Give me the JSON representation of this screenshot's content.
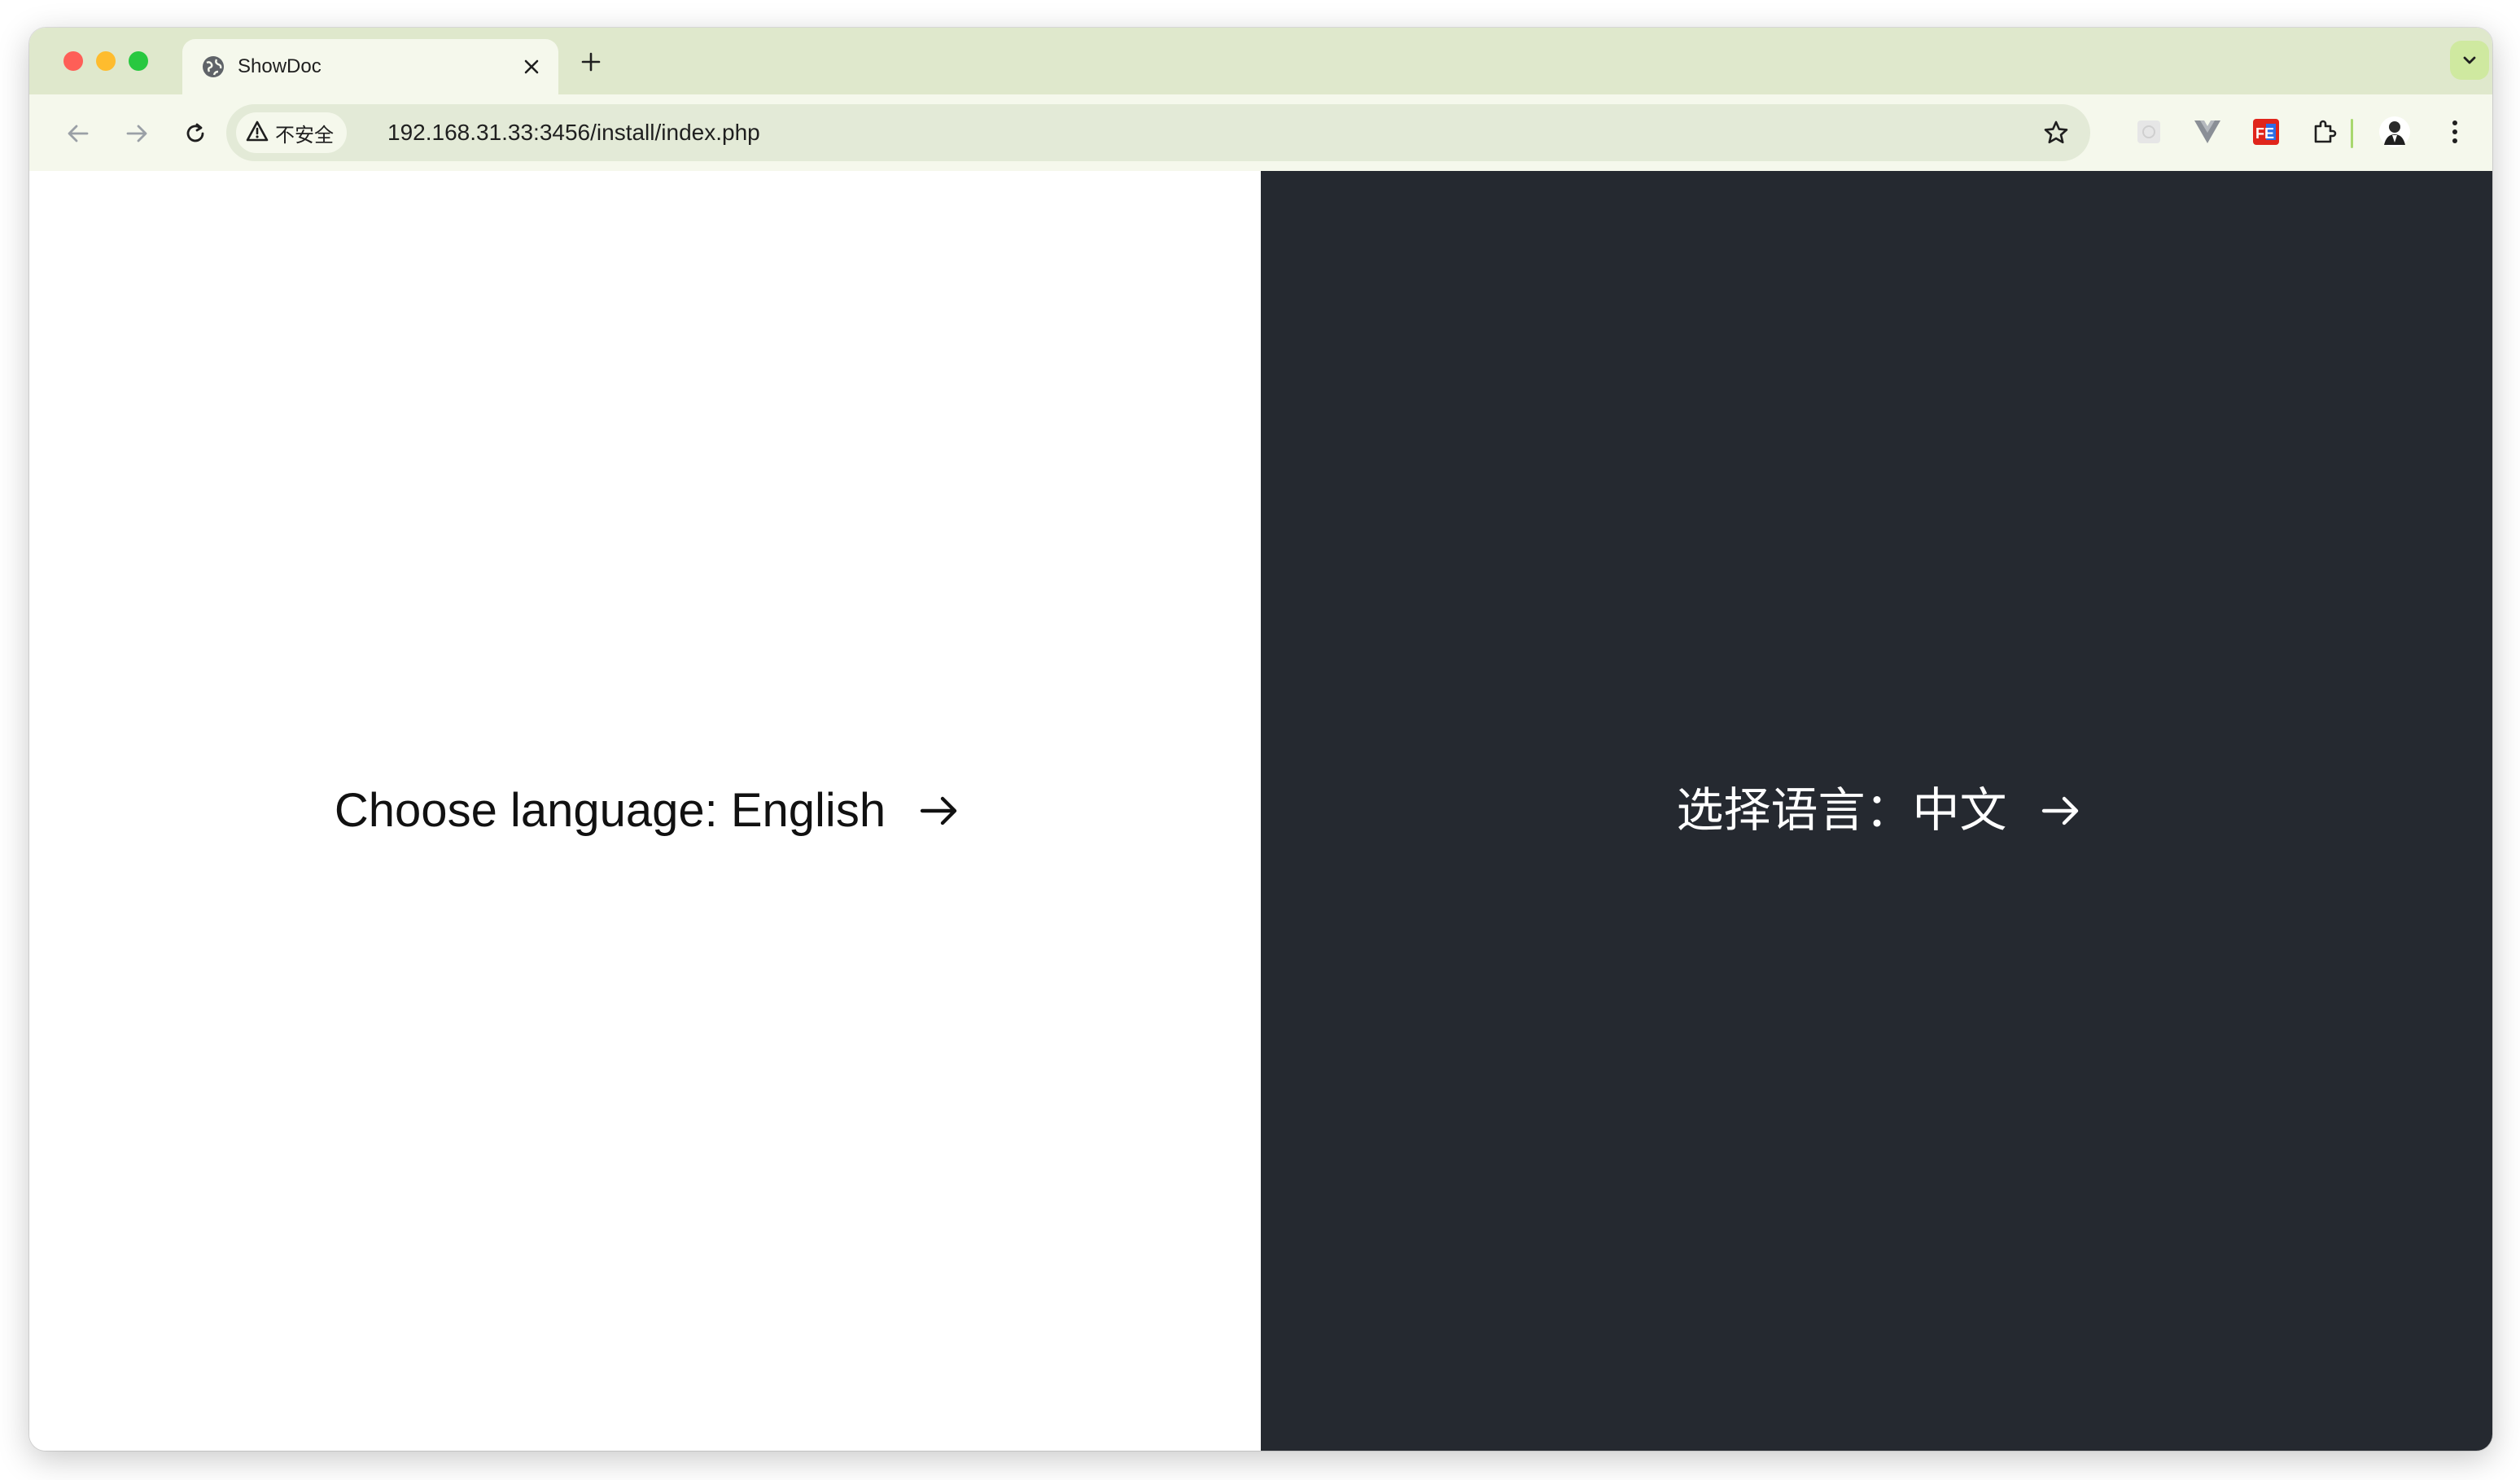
{
  "browser": {
    "tab": {
      "title": "ShowDoc",
      "close_glyph": "✕"
    },
    "new_tab_glyph": "+",
    "address_bar": {
      "security_label": "不安全",
      "url": "192.168.31.33:3456/install/index.php"
    },
    "colors": {
      "tabstrip": "#dfe8cc",
      "toolbar": "#f5f8ec",
      "omnibox": "#e3ead7"
    },
    "icons": [
      "back-icon",
      "forward-icon",
      "reload-icon",
      "warning-icon",
      "bookmark-star-icon",
      "extension-icon",
      "profile-avatar-icon",
      "more-menu-icon"
    ]
  },
  "page": {
    "english_option": {
      "label": "Choose language: English",
      "arrow": "→"
    },
    "chinese_option": {
      "label": "选择语言：中文",
      "arrow": "→"
    },
    "colors": {
      "left_bg": "#ffffff",
      "right_bg": "#252930"
    }
  }
}
